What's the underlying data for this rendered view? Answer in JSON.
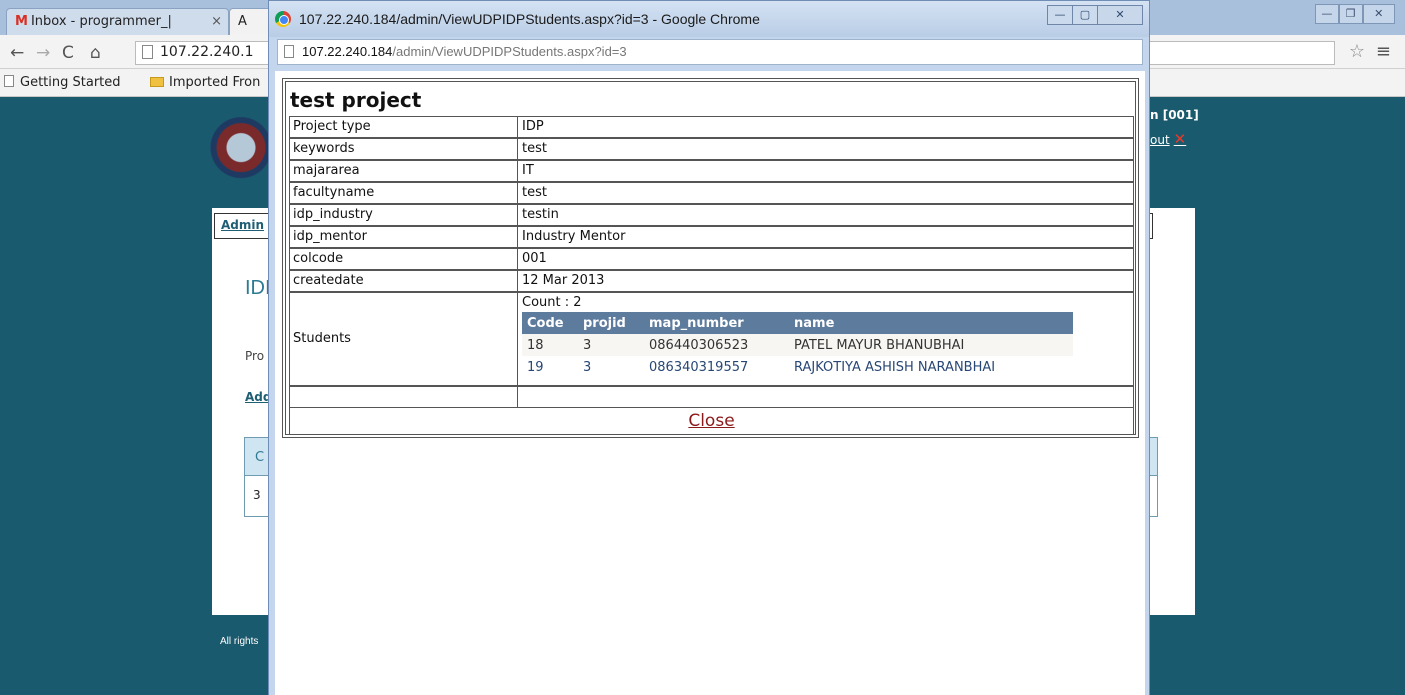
{
  "background_browser": {
    "tabs": [
      {
        "label": "Inbox - programmer_|"
      },
      {
        "label": "A"
      }
    ],
    "address": "107.22.240.1",
    "bookmarks": [
      "Getting Started",
      "Imported Fron"
    ]
  },
  "background_page": {
    "header_user": "n [001]",
    "logout_label": "out",
    "admin_tab": "Admin",
    "heading": "IDI",
    "project_label": "Pro",
    "add_link": "Add",
    "grid_header_cell": "C",
    "grid_row_cell": "3",
    "footer": "All rights"
  },
  "popup": {
    "window_title": "107.22.240.184/admin/ViewUDPIDPStudents.aspx?id=3 - Google Chrome",
    "url_host": "107.22.240.184",
    "url_path": "/admin/ViewUDPIDPStudents.aspx?id=3",
    "project_title": "test project",
    "details": [
      {
        "label": "Project type",
        "value": "IDP"
      },
      {
        "label": "keywords",
        "value": "test"
      },
      {
        "label": "majararea",
        "value": "IT"
      },
      {
        "label": "facultyname",
        "value": "test"
      },
      {
        "label": "idp_industry",
        "value": "testin"
      },
      {
        "label": "idp_mentor",
        "value": "Industry Mentor"
      },
      {
        "label": "colcode",
        "value": "001"
      },
      {
        "label": "createdate",
        "value": "12 Mar 2013"
      }
    ],
    "students_label": "Students",
    "students_count": "Count : 2",
    "students_columns": [
      "Code",
      "projid",
      "map_number",
      "name"
    ],
    "students_rows": [
      [
        "18",
        "3",
        "086440306523",
        "PATEL MAYUR BHANUBHAI"
      ],
      [
        "19",
        "3",
        "086340319557",
        "RAJKOTIYA ASHISH NARANBHAI"
      ]
    ],
    "close_label": "Close"
  },
  "colors": {
    "page_background": "#1a5a6e",
    "grid_header": "#5d7b9d",
    "close_link": "#8b1a1a"
  }
}
